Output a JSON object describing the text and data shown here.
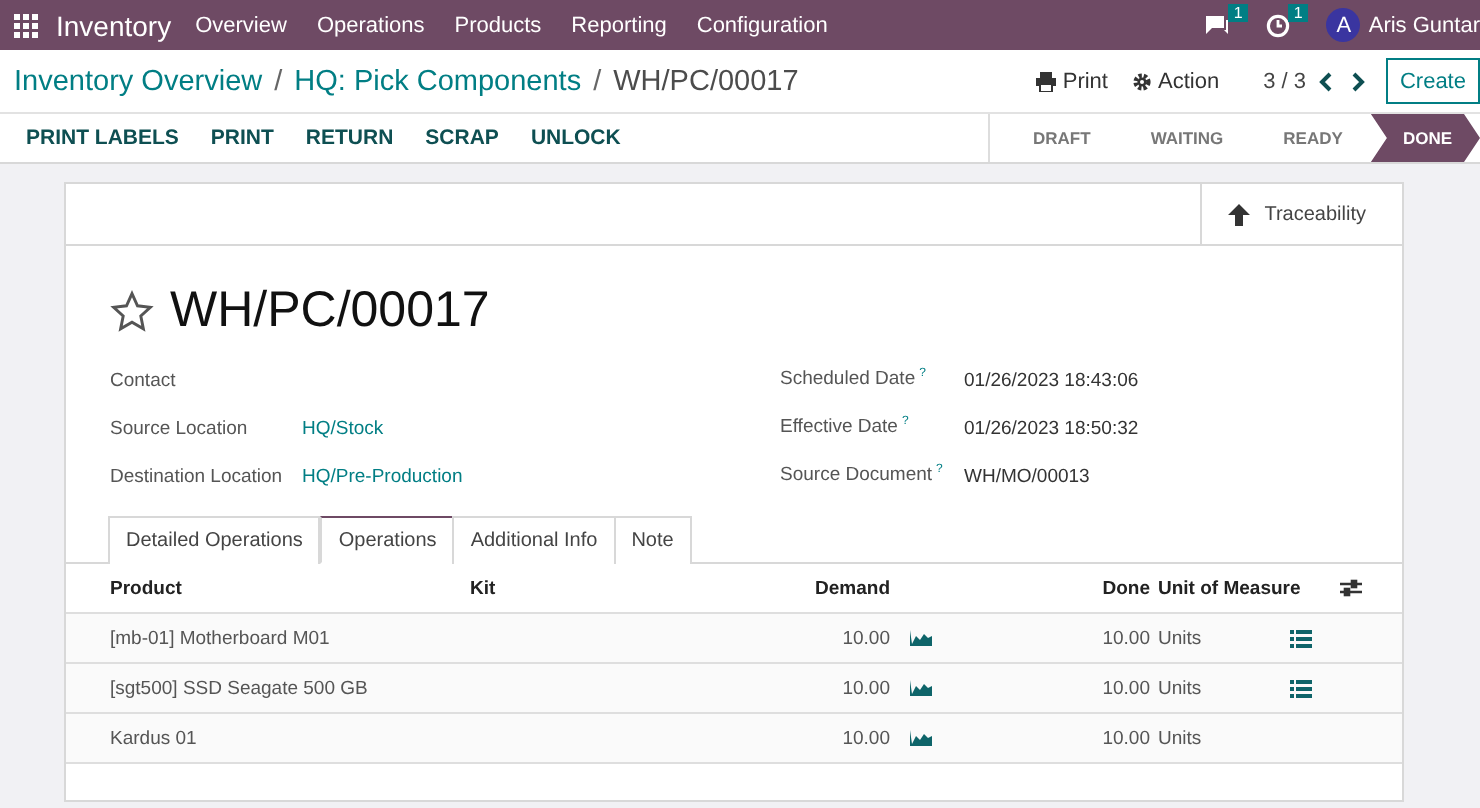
{
  "navbar": {
    "app": "Inventory",
    "menu": [
      "Overview",
      "Operations",
      "Products",
      "Reporting",
      "Configuration"
    ],
    "messages_count": "1",
    "activities_count": "1",
    "avatar": "A",
    "user": "Aris Guntar"
  },
  "breadcrumb": [
    "Inventory Overview",
    "HQ: Pick Components",
    "WH/PC/00017"
  ],
  "breadcrumb_separator": "/",
  "actions": {
    "print": "Print",
    "action": "Action",
    "pager": "3 / 3",
    "create": "Create"
  },
  "buttons": [
    "PRINT LABELS",
    "PRINT",
    "RETURN",
    "SCRAP",
    "UNLOCK"
  ],
  "stages": [
    {
      "label": "DRAFT",
      "selected": false
    },
    {
      "label": "WAITING",
      "selected": false
    },
    {
      "label": "READY",
      "selected": false
    },
    {
      "label": "DONE",
      "selected": true
    }
  ],
  "smart_button": "Traceability",
  "record": {
    "title": "WH/PC/00017",
    "starred": false
  },
  "left_fields": [
    {
      "label": "Contact"
    },
    {
      "label": "Source Location",
      "value": "HQ/Stock"
    },
    {
      "label": "Destination Location",
      "value": "HQ/Pre-Production"
    }
  ],
  "right_fields": [
    {
      "label": "Scheduled Date",
      "help": "?",
      "value": "01/26/2023 18:43:06"
    },
    {
      "label": "Effective Date",
      "help": "?",
      "value": "01/26/2023 18:50:32"
    },
    {
      "label": "Source Document",
      "help": "?",
      "value": "WH/MO/00013"
    }
  ],
  "tabs": [
    {
      "label": "Detailed Operations",
      "selected": false
    },
    {
      "label": "Operations",
      "selected": true
    },
    {
      "label": "Additional Info",
      "selected": false
    },
    {
      "label": "Note",
      "selected": false
    }
  ],
  "table": {
    "columns": [
      "Product",
      "Kit",
      "Demand",
      "Done",
      "Unit of Measure"
    ],
    "rows": [
      {
        "product": "[mb-01] Motherboard M01",
        "demand": "10.00",
        "done": "10.00",
        "uom": "Units",
        "details": true
      },
      {
        "product": "[sgt500] SSD Seagate 500 GB",
        "demand": "10.00",
        "done": "10.00",
        "uom": "Units",
        "details": true
      },
      {
        "product": "Kardus 01",
        "demand": "10.00",
        "done": "10.00",
        "uom": "Units",
        "details": false
      }
    ]
  }
}
